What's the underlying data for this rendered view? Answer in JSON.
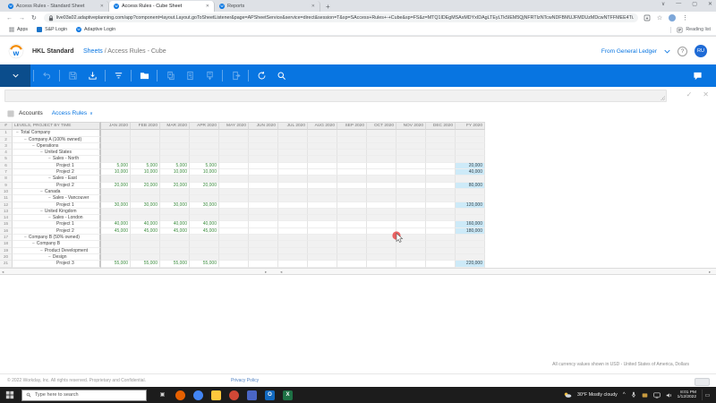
{
  "colors": {
    "workday_blue": "#0875e1",
    "leaf_value_green": "#3e8e41",
    "fy_cell_blue": "#cdeaf8",
    "taskbar_bg": "#1c1c1c"
  },
  "browser": {
    "tabs": [
      {
        "title": "Access Rules - Standard Sheet",
        "active": false
      },
      {
        "title": "Access Rules - Cube Sheet",
        "active": true
      },
      {
        "title": "Reports",
        "active": false
      }
    ],
    "new_tab_label": "+",
    "window_controls": {
      "tab_search": "∨",
      "minimize": "—",
      "maximize": "▢",
      "close": "✕"
    },
    "nav": {
      "back": "←",
      "forward": "→",
      "reload": "↻"
    },
    "url": "live03a02.adaptiveplanning.com/app?component=layout.Layout.goToSheetListener&page=APSheetService&service=direct&session=T&sp=SAccess+Rules+-+Cube&sp=FS&z=MTQ1IDEgMSAxMDYxIDAgLTEyLTk5IEM5QjNFRTIzNTcwNDFBMUJFMDUzMDcwNTFFMEE4Ti...",
    "bookmarks": [
      {
        "label": "Apps",
        "icon": "apps-grid"
      },
      {
        "label": "S&P Login",
        "icon": "blue-square"
      },
      {
        "label": "Adaptive Login",
        "icon": "workday-w"
      }
    ],
    "reading_list": "Reading list"
  },
  "header": {
    "org_name": "HKL Standard",
    "breadcrumb_link": "Sheets",
    "breadcrumb_rest": " / Access Rules - Cube",
    "from_general_ledger": "From General Ledger",
    "help": "?",
    "avatar_initials": "RU"
  },
  "toolbar": {
    "icons": [
      {
        "name": "menu-chevron-icon",
        "enabled": true
      },
      {
        "name": "undo-icon",
        "enabled": false
      },
      {
        "name": "save-icon",
        "enabled": false
      },
      {
        "name": "download-icon",
        "enabled": true
      },
      {
        "name": "filter-icon",
        "enabled": true
      },
      {
        "name": "folder-icon",
        "enabled": true
      },
      {
        "name": "copy-sheet-icon",
        "enabled": false
      },
      {
        "name": "export-sheet-icon",
        "enabled": false
      },
      {
        "name": "add-sheet-icon",
        "enabled": false
      },
      {
        "name": "move-sheet-icon",
        "enabled": false
      },
      {
        "name": "refresh-icon",
        "enabled": true
      },
      {
        "name": "search-icon",
        "enabled": true
      }
    ],
    "comment_icon": "comment-icon"
  },
  "formula_bar": {
    "value": "",
    "confirm": "✓",
    "cancel": "✕"
  },
  "sheet_bar": {
    "dimension": "Accounts",
    "view": "Access Rules",
    "chevron": "∨"
  },
  "grid": {
    "corner": "#",
    "row_header": "LEVELS, PROJECT BY TIME",
    "columns": [
      "JAN 2020",
      "FEB 2020",
      "MAR 2020",
      "APR 2020",
      "MAY 2020",
      "JUN 2020",
      "JUL 2020",
      "AUG 2020",
      "SEP 2020",
      "OCT 2020",
      "NOV 2020",
      "DEC 2020",
      "FY 2020"
    ],
    "rows": [
      {
        "num": 1,
        "label": "Total Company",
        "indent": 0,
        "type": "parent",
        "months": [
          "",
          "",
          "",
          "",
          "",
          "",
          "",
          "",
          "",
          "",
          "",
          ""
        ],
        "fy": ""
      },
      {
        "num": 2,
        "label": "Company A (100% owned)",
        "indent": 1,
        "type": "parent",
        "months": [
          "",
          "",
          "",
          "",
          "",
          "",
          "",
          "",
          "",
          "",
          "",
          ""
        ],
        "fy": ""
      },
      {
        "num": 3,
        "label": "Operations",
        "indent": 2,
        "type": "parent",
        "months": [
          "",
          "",
          "",
          "",
          "",
          "",
          "",
          "",
          "",
          "",
          "",
          ""
        ],
        "fy": ""
      },
      {
        "num": 4,
        "label": "United States",
        "indent": 3,
        "type": "parent",
        "months": [
          "",
          "",
          "",
          "",
          "",
          "",
          "",
          "",
          "",
          "",
          "",
          ""
        ],
        "fy": ""
      },
      {
        "num": 5,
        "label": "Sales - North",
        "indent": 4,
        "type": "parent",
        "months": [
          "",
          "",
          "",
          "",
          "",
          "",
          "",
          "",
          "",
          "",
          "",
          ""
        ],
        "fy": ""
      },
      {
        "num": 6,
        "label": "Project 1",
        "indent": 5,
        "type": "leaf",
        "months": [
          "5,000",
          "5,000",
          "5,000",
          "5,000",
          "",
          "",
          "",
          "",
          "",
          "",
          "",
          ""
        ],
        "fy": "20,000"
      },
      {
        "num": 7,
        "label": "Project 2",
        "indent": 5,
        "type": "leaf",
        "months": [
          "10,000",
          "10,000",
          "10,000",
          "10,000",
          "",
          "",
          "",
          "",
          "",
          "",
          "",
          ""
        ],
        "fy": "40,000"
      },
      {
        "num": 8,
        "label": "Sales - East",
        "indent": 4,
        "type": "parent",
        "months": [
          "",
          "",
          "",
          "",
          "",
          "",
          "",
          "",
          "",
          "",
          "",
          ""
        ],
        "fy": ""
      },
      {
        "num": 9,
        "label": "Project 2",
        "indent": 5,
        "type": "leaf",
        "months": [
          "20,000",
          "20,000",
          "20,000",
          "20,000",
          "",
          "",
          "",
          "",
          "",
          "",
          "",
          ""
        ],
        "fy": "80,000"
      },
      {
        "num": 10,
        "label": "Canada",
        "indent": 3,
        "type": "parent",
        "months": [
          "",
          "",
          "",
          "",
          "",
          "",
          "",
          "",
          "",
          "",
          "",
          ""
        ],
        "fy": ""
      },
      {
        "num": 11,
        "label": "Sales - Vancouver",
        "indent": 4,
        "type": "parent",
        "months": [
          "",
          "",
          "",
          "",
          "",
          "",
          "",
          "",
          "",
          "",
          "",
          ""
        ],
        "fy": ""
      },
      {
        "num": 12,
        "label": "Project 1",
        "indent": 5,
        "type": "leaf",
        "months": [
          "30,000",
          "30,000",
          "30,000",
          "30,000",
          "",
          "",
          "",
          "",
          "",
          "",
          "",
          ""
        ],
        "fy": "120,000"
      },
      {
        "num": 13,
        "label": "United Kingdom",
        "indent": 3,
        "type": "parent",
        "months": [
          "",
          "",
          "",
          "",
          "",
          "",
          "",
          "",
          "",
          "",
          "",
          ""
        ],
        "fy": ""
      },
      {
        "num": 14,
        "label": "Sales - London",
        "indent": 4,
        "type": "parent",
        "months": [
          "",
          "",
          "",
          "",
          "",
          "",
          "",
          "",
          "",
          "",
          "",
          ""
        ],
        "fy": ""
      },
      {
        "num": 15,
        "label": "Project 1",
        "indent": 5,
        "type": "leaf",
        "months": [
          "40,000",
          "40,000",
          "40,000",
          "40,000",
          "",
          "",
          "",
          "",
          "",
          "",
          "",
          ""
        ],
        "fy": "160,000"
      },
      {
        "num": 16,
        "label": "Project 2",
        "indent": 5,
        "type": "leaf",
        "months": [
          "45,000",
          "45,000",
          "45,000",
          "45,000",
          "",
          "",
          "",
          "",
          "",
          "",
          "",
          ""
        ],
        "fy": "180,000"
      },
      {
        "num": 17,
        "label": "Company B (50% owned)",
        "indent": 1,
        "type": "parent",
        "months": [
          "",
          "",
          "",
          "",
          "",
          "",
          "",
          "",
          "",
          "",
          "",
          ""
        ],
        "fy": ""
      },
      {
        "num": 18,
        "label": "Company B",
        "indent": 2,
        "type": "parent",
        "months": [
          "",
          "",
          "",
          "",
          "",
          "",
          "",
          "",
          "",
          "",
          "",
          ""
        ],
        "fy": ""
      },
      {
        "num": 19,
        "label": "Product Development",
        "indent": 3,
        "type": "parent",
        "months": [
          "",
          "",
          "",
          "",
          "",
          "",
          "",
          "",
          "",
          "",
          "",
          ""
        ],
        "fy": ""
      },
      {
        "num": 20,
        "label": "Design",
        "indent": 4,
        "type": "parent",
        "months": [
          "",
          "",
          "",
          "",
          "",
          "",
          "",
          "",
          "",
          "",
          "",
          ""
        ],
        "fy": ""
      },
      {
        "num": 21,
        "label": "Project 3",
        "indent": 5,
        "type": "leaf",
        "months": [
          "55,000",
          "55,000",
          "55,000",
          "55,000",
          "",
          "",
          "",
          "",
          "",
          "",
          "",
          ""
        ],
        "fy": "220,000"
      }
    ],
    "collapse_marker": "−",
    "scroll_arrows": {
      "left": "◂",
      "right": "▸"
    }
  },
  "footer": {
    "currency_note": "All currency values shown in USD - United States of America, Dollars",
    "copyright": "© 2022 Workday, Inc. All rights reserved. Proprietary and Confidential.",
    "privacy_policy": "Privacy Policy"
  },
  "taskbar": {
    "search_placeholder": "Type here to search",
    "apps": [
      {
        "name": "task-view-icon",
        "bg": "transparent",
        "glyph": "▣"
      },
      {
        "name": "firefox-icon",
        "bg": "#e66000",
        "glyph": "",
        "round": true
      },
      {
        "name": "chrome-icon",
        "bg": "#4285f4",
        "glyph": "",
        "round": true
      },
      {
        "name": "file-explorer-icon",
        "bg": "#ffc83d",
        "glyph": ""
      },
      {
        "name": "edge-icon",
        "bg": "#d14836",
        "glyph": "",
        "round": true
      },
      {
        "name": "teams-icon",
        "bg": "#4a66c6",
        "glyph": ""
      },
      {
        "name": "outlook-icon",
        "bg": "#1269bf",
        "glyph": "O"
      },
      {
        "name": "excel-icon",
        "bg": "#1e7145",
        "glyph": "X"
      }
    ],
    "tray": {
      "weather": "30°F  Mostly cloudy",
      "expand": "^",
      "time": "8:01 PM",
      "date": "1/12/2022"
    }
  }
}
